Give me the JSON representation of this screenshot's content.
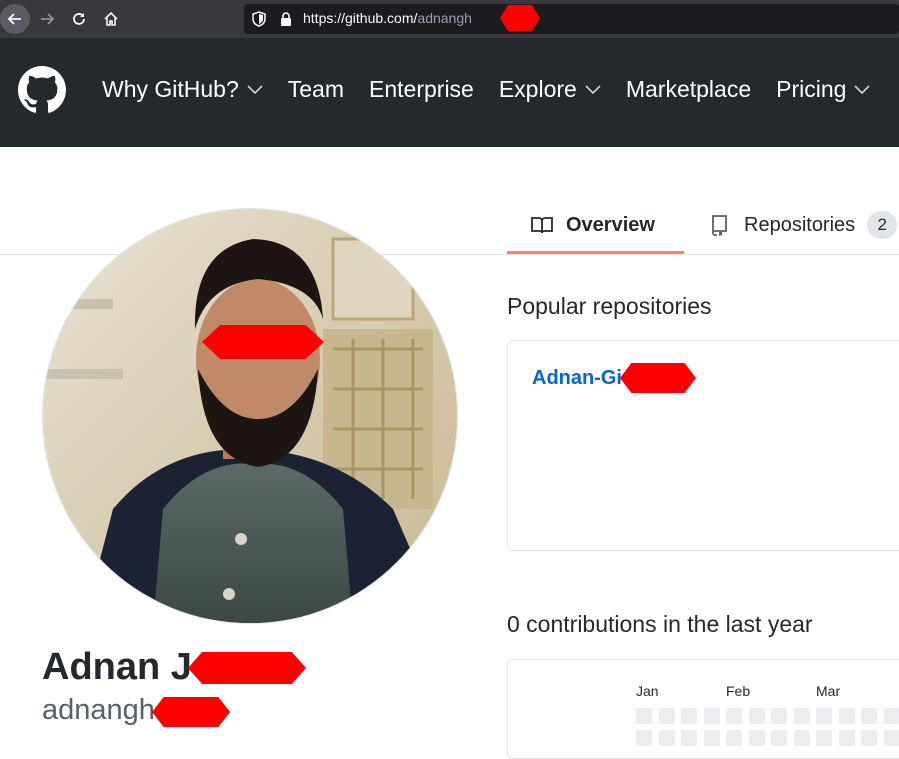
{
  "browser": {
    "url_host": "https://github.com/",
    "url_path": "adnangh"
  },
  "header": {
    "nav": [
      {
        "label": "Why GitHub?",
        "has_dropdown": true
      },
      {
        "label": "Team",
        "has_dropdown": false
      },
      {
        "label": "Enterprise",
        "has_dropdown": false
      },
      {
        "label": "Explore",
        "has_dropdown": true
      },
      {
        "label": "Marketplace",
        "has_dropdown": false
      },
      {
        "label": "Pricing",
        "has_dropdown": true
      }
    ]
  },
  "tabs": {
    "overview_label": "Overview",
    "repositories_label": "Repositories",
    "repositories_count": "2"
  },
  "profile": {
    "fullname": "Adnan J",
    "username": "adnangh"
  },
  "popular": {
    "title": "Popular repositories",
    "repo_name": "Adnan-Gi"
  },
  "contributions": {
    "title": "0 contributions in the last year",
    "months": [
      "Jan",
      "Feb",
      "Mar"
    ]
  },
  "colors": {
    "header_bg": "#24292e",
    "tab_underline": "#f9826c",
    "link": "#0366d6",
    "redaction": "#ff0000"
  }
}
